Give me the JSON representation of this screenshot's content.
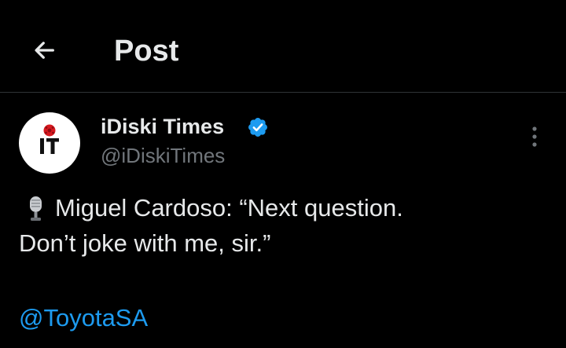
{
  "header": {
    "back_icon": "arrow-left-icon",
    "title": "Post"
  },
  "author": {
    "avatar_icon": "idiski-times-logo",
    "avatar_text": "iT",
    "display_name": "iDiski Times",
    "verified_icon": "verified-badge-icon",
    "handle": "@iDiskiTimes",
    "more_icon": "more-vertical-icon"
  },
  "post": {
    "emoji": "microphone-icon",
    "line1": "Miguel Cardoso: “Next question.",
    "line2": "Don’t joke with me, sir.”",
    "mention": "@ToyotaSA"
  },
  "colors": {
    "background": "#000000",
    "text": "#e7e9ea",
    "secondary": "#71767b",
    "accent": "#1d9bf0",
    "logo_red": "#d71920",
    "divider": "#2f3336"
  }
}
